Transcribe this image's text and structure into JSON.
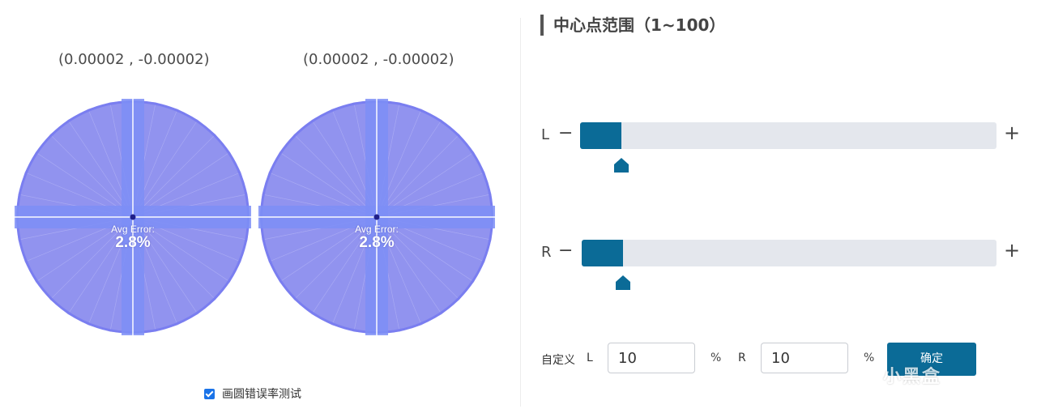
{
  "left": {
    "circles": [
      {
        "coord_label": "(0.00002 , -0.00002)",
        "error_label": "Avg Error:",
        "error_value": "2.8%"
      },
      {
        "coord_label": "(0.00002 , -0.00002)",
        "error_label": "Avg Error:",
        "error_value": "2.8%"
      }
    ],
    "test_checkbox": {
      "label": "画圆错误率测试",
      "checked": true
    }
  },
  "right": {
    "title": "中心点范围（1~100）",
    "sliders": [
      {
        "name": "L",
        "minus": "−",
        "plus": "+",
        "value": 10,
        "max": 100
      },
      {
        "name": "R",
        "minus": "−",
        "plus": "+",
        "value": 10,
        "max": 100
      }
    ],
    "custom": {
      "label": "自定义",
      "l_letter": "L",
      "l_value": "10",
      "l_unit": "%",
      "r_letter": "R",
      "r_value": "10",
      "r_unit": "%",
      "confirm_label": "确定"
    }
  },
  "watermark": "小黑盒",
  "colors": {
    "accent": "#0b6b97",
    "track": "#e4e7ed",
    "circle_fill": "#9193ef",
    "circle_edge": "#7a7ef0",
    "axis_band": "#7c8ef6",
    "checkbox": "#1a73e8"
  },
  "icons": {
    "handle": "pentagon-handle-icon",
    "check": "checkmark-icon",
    "watermark_logo": "heybox-logo-icon"
  }
}
